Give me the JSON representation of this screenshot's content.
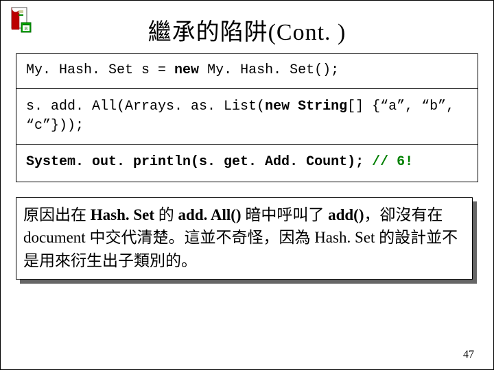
{
  "title": "繼承的陷阱(Cont. )",
  "code": {
    "line1_pre": "My. Hash. Set s = ",
    "line1_kw": "new",
    "line1_post": " My. Hash. Set();",
    "line2_pre": "s. add. All(Arrays. as. List(",
    "line2_kw": "new",
    "line2_sp": " ",
    "line2_type": "String",
    "line2_post_a": "[] {“a”, “b”,",
    "line2_post_b": "“c”}));",
    "line3_pre": "System. out. println(s. get. Add. Count); ",
    "line3_comment": "// 6!"
  },
  "explain": {
    "t1": "原因出在 ",
    "m1": "Hash. Set",
    "t2": " 的 ",
    "m2": "add. All()",
    "t3": " 暗中呼叫了 ",
    "m3": "add()",
    "t4": "，卻沒有在 document 中交代清楚。這並不奇怪，因為 Hash. Set 的設計並不是用來衍生出子類別的。"
  },
  "pagenum": "47"
}
